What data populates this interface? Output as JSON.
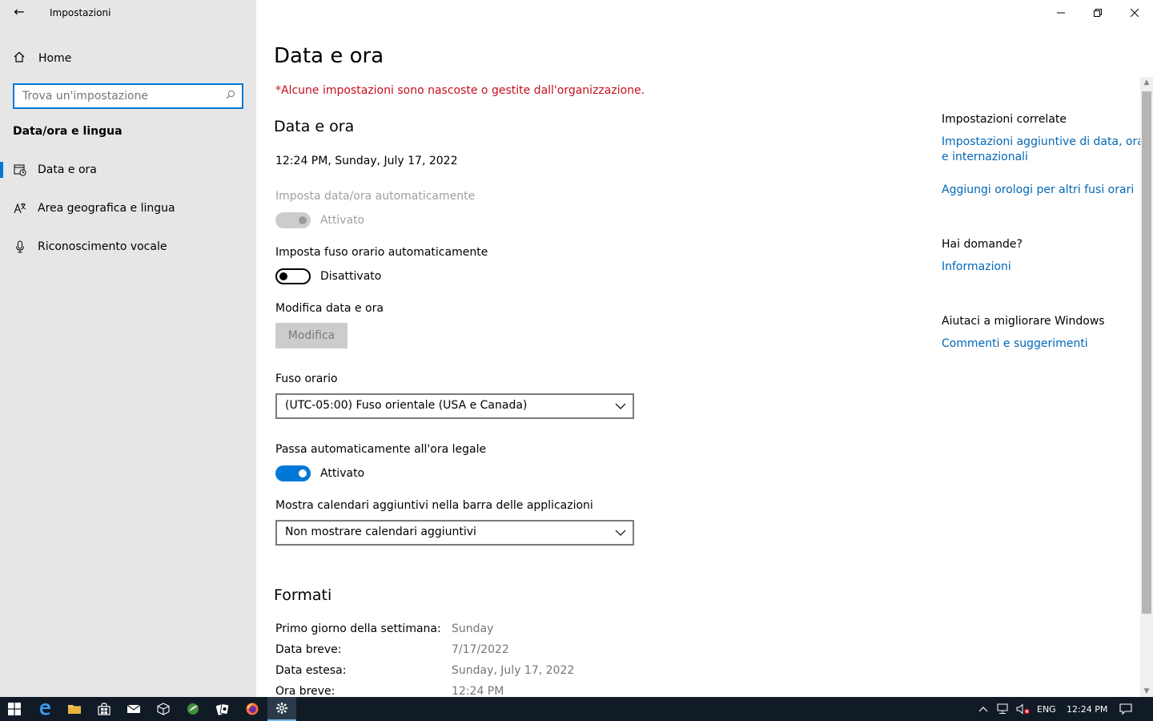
{
  "window": {
    "title": "Impostazioni"
  },
  "sidebar": {
    "home_label": "Home",
    "search_placeholder": "Trova un'impostazione",
    "section_title": "Data/ora e lingua",
    "items": [
      {
        "label": "Data e ora",
        "icon": "clock-calendar-icon",
        "active": true
      },
      {
        "label": "Area geografica e lingua",
        "icon": "language-icon",
        "active": false
      },
      {
        "label": "Riconoscimento vocale",
        "icon": "microphone-icon",
        "active": false
      }
    ]
  },
  "main": {
    "page_title": "Data e ora",
    "org_warning": "*Alcune impostazioni sono nascoste o gestite dall'organizzazione.",
    "section_title": "Data e ora",
    "current_datetime": "12:24 PM, Sunday, July 17, 2022",
    "auto_time": {
      "label": "Imposta data/ora automaticamente",
      "state_label": "Attivato",
      "on": true,
      "disabled": true
    },
    "auto_timezone": {
      "label": "Imposta fuso orario automaticamente",
      "state_label": "Disattivato",
      "on": false
    },
    "change_datetime": {
      "label": "Modifica data e ora",
      "button_label": "Modifica"
    },
    "timezone": {
      "label": "Fuso orario",
      "value": "(UTC-05:00) Fuso orientale (USA e Canada)"
    },
    "dst": {
      "label": "Passa automaticamente all'ora legale",
      "state_label": "Attivato",
      "on": true
    },
    "extra_calendars": {
      "label": "Mostra calendari aggiuntivi nella barra delle applicazioni",
      "value": "Non mostrare calendari aggiuntivi"
    },
    "formats": {
      "title": "Formati",
      "rows": [
        {
          "label": "Primo giorno della settimana:",
          "value": "Sunday"
        },
        {
          "label": "Data breve:",
          "value": "7/17/2022"
        },
        {
          "label": "Data estesa:",
          "value": "Sunday, July 17, 2022"
        },
        {
          "label": "Ora breve:",
          "value": "12:24 PM"
        }
      ]
    }
  },
  "related": {
    "title": "Impostazioni correlate",
    "link1_line1": "Impostazioni aggiuntive di data, ora",
    "link1_line2": "e internazionali",
    "link2": "Aggiungi orologi per altri fusi orari",
    "questions_title": "Hai domande?",
    "questions_link": "Informazioni",
    "improve_title": "Aiutaci a migliorare Windows",
    "improve_link": "Commenti e suggerimenti"
  },
  "taskbar": {
    "language": "ENG",
    "clock": "12:24 PM"
  },
  "colors": {
    "accent": "#0078d7",
    "warning": "#c50f1f",
    "link": "#0067b8",
    "sidebar_bg": "#e6e6e6",
    "taskbar_bg": "#101b26"
  }
}
